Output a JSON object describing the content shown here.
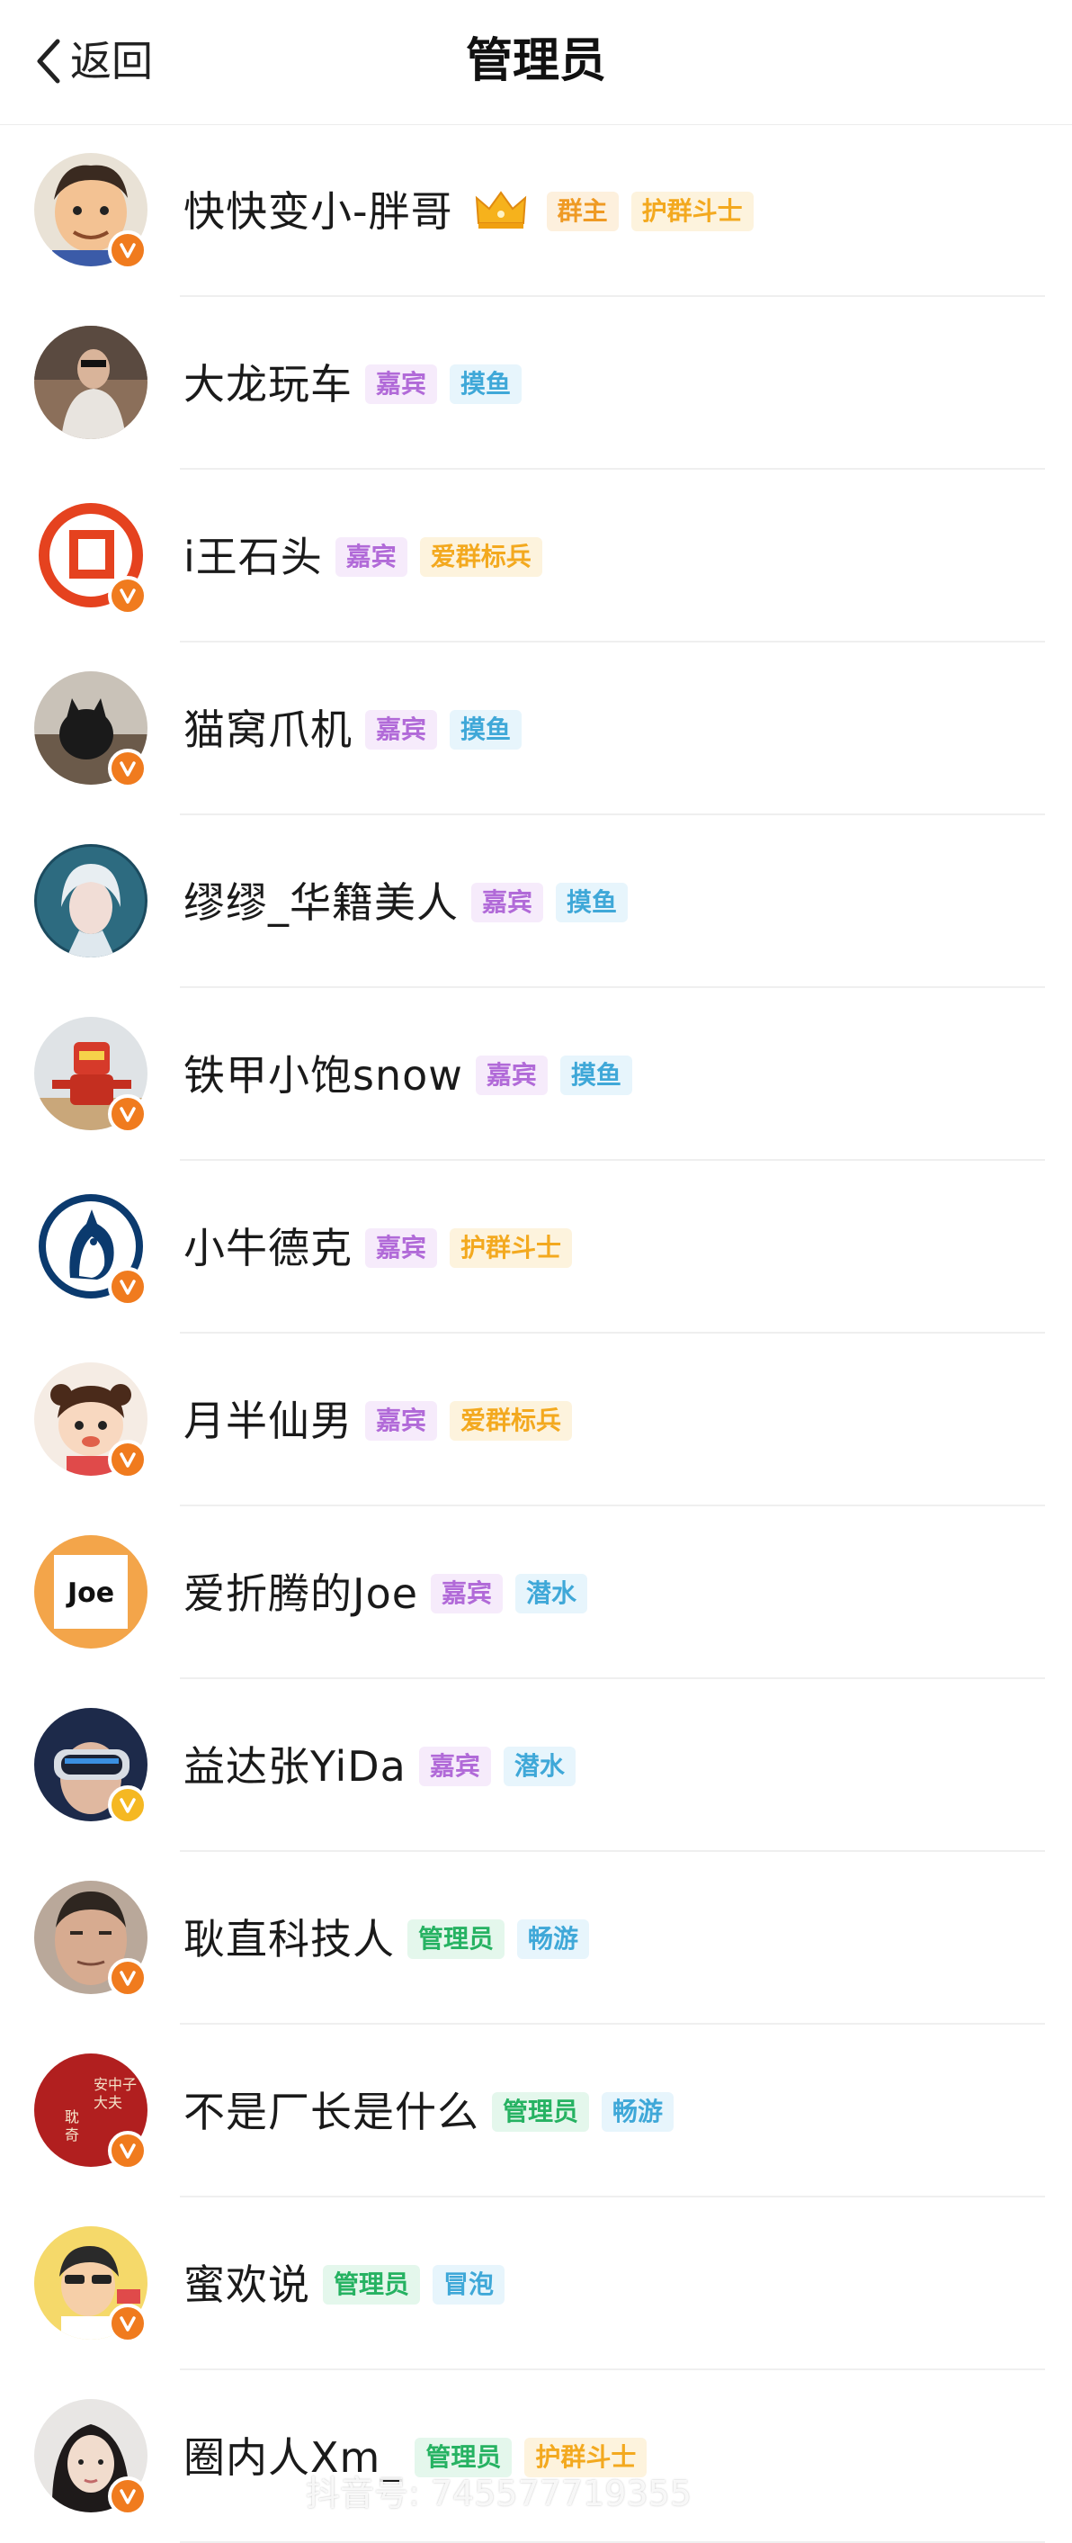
{
  "header": {
    "back_label": "返回",
    "title": "管理员"
  },
  "members": [
    {
      "name": "快快变小-胖哥",
      "crown": true,
      "verified": "orange",
      "avatar": "cartoon-man-icon",
      "tags": [
        {
          "label": "群主",
          "kind": "owner"
        },
        {
          "label": "护群斗士",
          "kind": "guard"
        }
      ]
    },
    {
      "name": "大龙玩车",
      "crown": false,
      "verified": "none",
      "avatar": "photo-man-icon",
      "tags": [
        {
          "label": "嘉宾",
          "kind": "guest"
        },
        {
          "label": "摸鱼",
          "kind": "fish"
        }
      ]
    },
    {
      "name": "i王石头",
      "crown": false,
      "verified": "orange",
      "avatar": "logo-icon",
      "tags": [
        {
          "label": "嘉宾",
          "kind": "guest"
        },
        {
          "label": "爱群标兵",
          "kind": "soldier"
        }
      ]
    },
    {
      "name": "猫窝爪机",
      "crown": false,
      "verified": "orange",
      "avatar": "cat-photo-icon",
      "tags": [
        {
          "label": "嘉宾",
          "kind": "guest"
        },
        {
          "label": "摸鱼",
          "kind": "fish"
        }
      ]
    },
    {
      "name": "缪缪_华籍美人",
      "crown": false,
      "verified": "none",
      "avatar": "girl-portrait-icon",
      "tags": [
        {
          "label": "嘉宾",
          "kind": "guest"
        },
        {
          "label": "摸鱼",
          "kind": "fish"
        }
      ]
    },
    {
      "name": "铁甲小饱snow",
      "crown": false,
      "verified": "orange",
      "avatar": "robot-icon",
      "tags": [
        {
          "label": "嘉宾",
          "kind": "guest"
        },
        {
          "label": "摸鱼",
          "kind": "fish"
        }
      ]
    },
    {
      "name": "小牛德克",
      "crown": false,
      "verified": "orange",
      "avatar": "horse-logo-icon",
      "tags": [
        {
          "label": "嘉宾",
          "kind": "guest"
        },
        {
          "label": "护群斗士",
          "kind": "guard"
        }
      ]
    },
    {
      "name": "月半仙男",
      "crown": false,
      "verified": "orange",
      "avatar": "cartoon-girl-icon",
      "tags": [
        {
          "label": "嘉宾",
          "kind": "guest"
        },
        {
          "label": "爱群标兵",
          "kind": "soldier"
        }
      ]
    },
    {
      "name": "爱折腾的Joe",
      "crown": false,
      "verified": "none",
      "avatar": "joe-logo",
      "avatar_text": "Joe",
      "tags": [
        {
          "label": "嘉宾",
          "kind": "guest"
        },
        {
          "label": "潜水",
          "kind": "fish"
        }
      ]
    },
    {
      "name": "益达张YiDa",
      "crown": false,
      "verified": "gold",
      "avatar": "vr-headset-icon",
      "tags": [
        {
          "label": "嘉宾",
          "kind": "guest"
        },
        {
          "label": "潜水",
          "kind": "fish"
        }
      ]
    },
    {
      "name": "耿直科技人",
      "crown": false,
      "verified": "orange",
      "avatar": "man-face-icon",
      "tags": [
        {
          "label": "管理员",
          "kind": "admin"
        },
        {
          "label": "畅游",
          "kind": "swim"
        }
      ]
    },
    {
      "name": "不是厂长是什么",
      "crown": false,
      "verified": "orange",
      "avatar": "red-seal-icon",
      "tags": [
        {
          "label": "管理员",
          "kind": "admin"
        },
        {
          "label": "畅游",
          "kind": "swim"
        }
      ]
    },
    {
      "name": "蜜欢说",
      "crown": false,
      "verified": "orange",
      "avatar": "cartoon-speaker-icon",
      "tags": [
        {
          "label": "管理员",
          "kind": "admin"
        },
        {
          "label": "冒泡",
          "kind": "fish"
        }
      ]
    },
    {
      "name": "圈内人Xm_",
      "crown": false,
      "verified": "orange",
      "avatar": "woman-portrait-icon",
      "tags": [
        {
          "label": "管理员",
          "kind": "admin"
        },
        {
          "label": "护群斗士",
          "kind": "guard"
        }
      ]
    }
  ],
  "watermark": "抖音号: 745577719355",
  "colors": {
    "verified_orange": "#f07b1e",
    "verified_gold": "#f5b822",
    "guest": "#b16ad8",
    "fish": "#3fa8d8",
    "guard": "#f3a91f",
    "admin": "#26b262"
  }
}
